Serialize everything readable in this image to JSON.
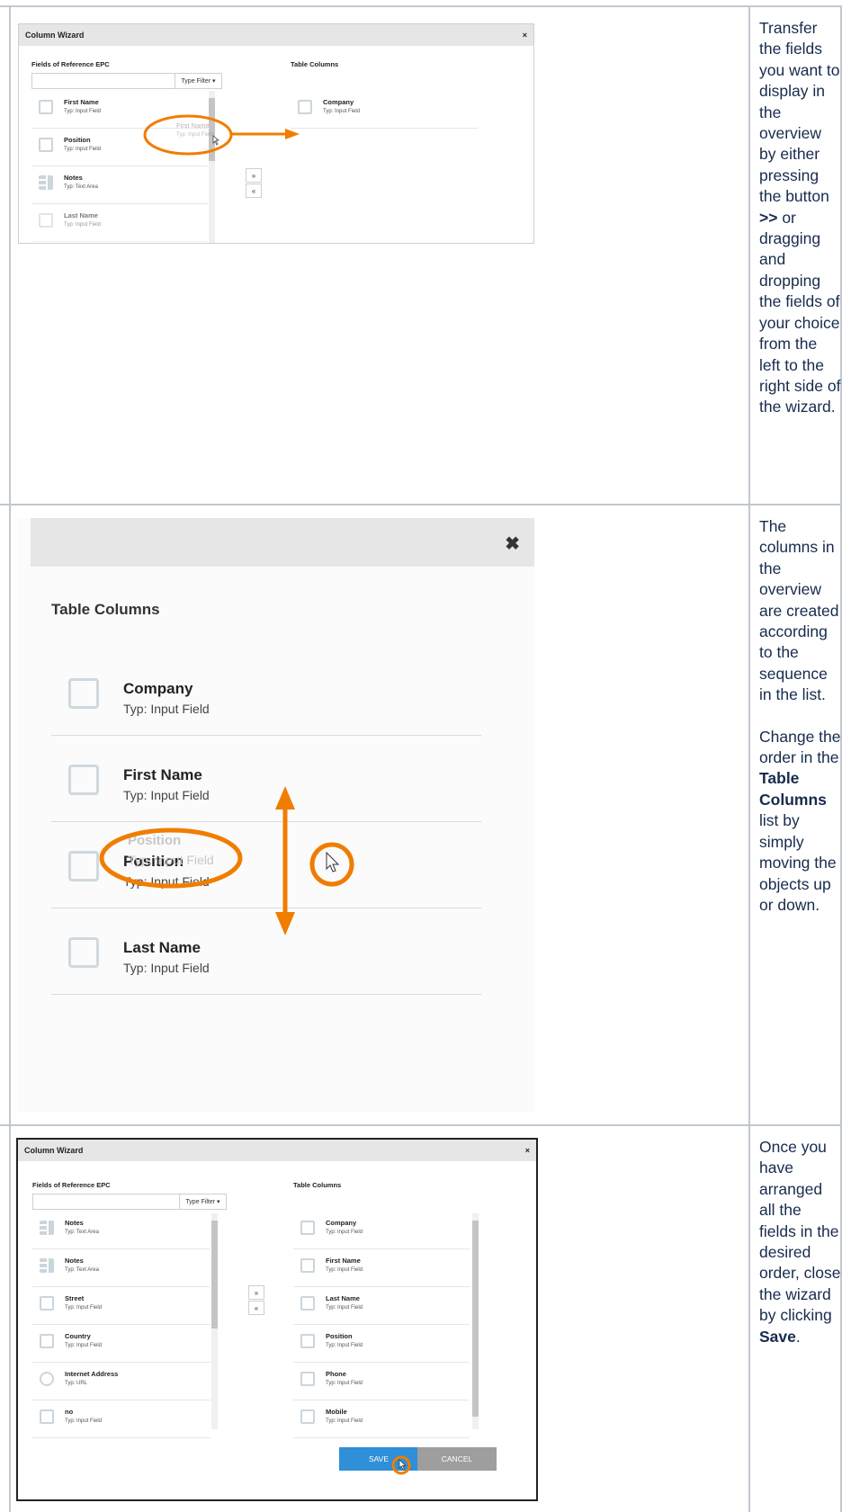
{
  "row1": {
    "description": "Transfer the fields you want to display in the overview by either pressing the button",
    "description_bold": ">>",
    "description_tail": "or dragging and dropping the fields of your choice from the left to the right side of the wizard.",
    "wizard": {
      "title": "Column Wizard",
      "close": "×",
      "left_label": "Fields of Reference EPC",
      "filter_button": "Type Filter ▾",
      "right_label": "Table Columns",
      "move_right": "»",
      "move_left": "«",
      "left_fields": [
        {
          "name": "First Name",
          "type": "Typ: Input Field",
          "icon": "edit-icon"
        },
        {
          "name": "Position",
          "type": "Typ: Input Field",
          "icon": "edit-icon"
        },
        {
          "name": "Notes",
          "type": "Typ: Text Area",
          "icon": "text-area-icon"
        },
        {
          "name": "Last Name",
          "type": "Typ: Input Field",
          "icon": "edit-icon"
        }
      ],
      "drag_ghost": {
        "name": "First Name",
        "type": "Typ: Input Field"
      },
      "right_fields": [
        {
          "name": "Company",
          "type": "Typ: Input Field",
          "icon": "edit-icon"
        }
      ]
    }
  },
  "row2": {
    "description_a": "The columns in the overview are created according to the sequence in the list.",
    "description_b_pre": "Change the order in the",
    "description_b_bold": "Table Columns",
    "description_b_post": "list by simply moving the objects up or down.",
    "zoom": {
      "close": "✖",
      "title": "Table Columns",
      "items": [
        {
          "name": "Company",
          "type": "Typ: Input Field"
        },
        {
          "name": "First Name",
          "type": "Typ: Input Field"
        },
        {
          "name": "Position",
          "type": "Typ: Input Field"
        },
        {
          "name": "Last Name",
          "type": "Typ: Input Field"
        }
      ],
      "ghost": {
        "name": "Position",
        "type": "Typ: Input Field"
      }
    }
  },
  "row3": {
    "description_pre": "Once you have arranged all the fields in the desired order, close the wizard by clicking",
    "description_bold": "Save",
    "description_post": ".",
    "wizard": {
      "title": "Column Wizard",
      "close": "×",
      "left_label": "Fields of Reference EPC",
      "filter_button": "Type Filter ▾",
      "right_label": "Table Columns",
      "move_right": "»",
      "move_left": "«",
      "left_fields": [
        {
          "name": "Notes",
          "type": "Typ: Text Area",
          "icon": "text-area-icon"
        },
        {
          "name": "Notes",
          "type": "Typ: Text Area",
          "icon": "text-area-icon"
        },
        {
          "name": "Street",
          "type": "Typ: Input Field",
          "icon": "edit-icon"
        },
        {
          "name": "Country",
          "type": "Typ: Input Field",
          "icon": "edit-icon"
        },
        {
          "name": "Internet Address",
          "type": "Typ: URL",
          "icon": "globe-icon"
        },
        {
          "name": "no",
          "type": "Typ: Input Field",
          "icon": "edit-icon"
        }
      ],
      "right_fields": [
        {
          "name": "Company",
          "type": "Typ: Input Field"
        },
        {
          "name": "First Name",
          "type": "Typ: Input Field"
        },
        {
          "name": "Last Name",
          "type": "Typ: Input Field"
        },
        {
          "name": "Position",
          "type": "Typ: Input Field"
        },
        {
          "name": "Phone",
          "type": "Typ: Input Field"
        },
        {
          "name": "Mobile",
          "type": "Typ: Input Field"
        }
      ],
      "save": "SAVE",
      "cancel": "CANCEL"
    }
  },
  "colors": {
    "accent_orange": "#f07d00",
    "save_blue": "#2f8fd8",
    "table_border": "#c1c7d0"
  }
}
